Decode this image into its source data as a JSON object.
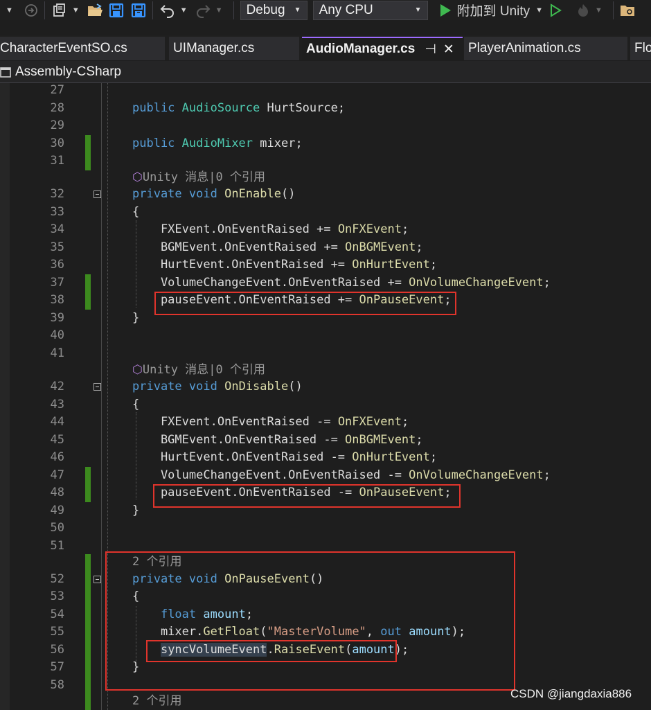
{
  "toolbar": {
    "config": "Debug",
    "platform": "Any CPU",
    "attach_label": "附加到 Unity",
    "icons": [
      "dropdown-caret",
      "navigate-forward-icon",
      "new-item-icon",
      "open-folder-icon",
      "save-icon",
      "save-all-icon",
      "undo-icon",
      "redo-icon",
      "play-icon",
      "start-without-debug-icon",
      "hot-reload-icon",
      "folder-view-icon"
    ]
  },
  "tabs": [
    {
      "label": "CharacterEventSO.cs"
    },
    {
      "label": "UIManager.cs"
    },
    {
      "label": "AudioManager.cs",
      "active": true,
      "pin": "⊣",
      "close": "✕"
    },
    {
      "label": "PlayerAnimation.cs"
    },
    {
      "label": "Flo"
    }
  ],
  "navbar": {
    "project": "Assembly-CSharp"
  },
  "lines": [
    {
      "n": "27"
    },
    {
      "n": "28",
      "code": "public AudioSource HurtSource;"
    },
    {
      "n": "29"
    },
    {
      "n": "30",
      "code": "public AudioMixer mixer;"
    },
    {
      "n": "31"
    },
    {
      "lens": "Unity 消息|0 个引用"
    },
    {
      "n": "32",
      "code": "private void OnEnable()"
    },
    {
      "n": "33",
      "code": "{"
    },
    {
      "n": "34",
      "code": "FXEvent.OnEventRaised += OnFXEvent;"
    },
    {
      "n": "35",
      "code": "BGMEvent.OnEventRaised += OnBGMEvent;"
    },
    {
      "n": "36",
      "code": "HurtEvent.OnEventRaised += OnHurtEvent;"
    },
    {
      "n": "37",
      "code": "VolumeChangeEvent.OnEventRaised += OnVolumeChangeEvent;"
    },
    {
      "n": "38",
      "code": "pauseEvent.OnEventRaised += OnPauseEvent;"
    },
    {
      "n": "39",
      "code": "}"
    },
    {
      "n": "40"
    },
    {
      "n": "41"
    },
    {
      "lens": "Unity 消息|0 个引用"
    },
    {
      "n": "42",
      "code": "private void OnDisable()"
    },
    {
      "n": "43",
      "code": "{"
    },
    {
      "n": "44",
      "code": "FXEvent.OnEventRaised -= OnFXEvent;"
    },
    {
      "n": "45",
      "code": "BGMEvent.OnEventRaised -= OnBGMEvent;"
    },
    {
      "n": "46",
      "code": "HurtEvent.OnEventRaised -= OnHurtEvent;"
    },
    {
      "n": "47",
      "code": "VolumeChangeEvent.OnEventRaised -= OnVolumeChangeEvent;"
    },
    {
      "n": "48",
      "code": "pauseEvent.OnEventRaised -= OnPauseEvent;"
    },
    {
      "n": "49",
      "code": "}"
    },
    {
      "n": "50"
    },
    {
      "n": "51"
    },
    {
      "lens": "2 个引用"
    },
    {
      "n": "52",
      "code": "private void OnPauseEvent()"
    },
    {
      "n": "53",
      "code": "{"
    },
    {
      "n": "54",
      "code": "float amount;"
    },
    {
      "n": "55",
      "code": "mixer.GetFloat(\"MasterVolume\", out amount);"
    },
    {
      "n": "56",
      "code": "syncVolumeEvent.RaiseEvent(amount);"
    },
    {
      "n": "57",
      "code": "}"
    },
    {
      "n": "58"
    },
    {
      "lens": "2 个引用"
    }
  ],
  "watermark": "CSDN @jiangdaxia886",
  "colors": {
    "keyword": "#569cd6",
    "type": "#4ec9b0",
    "method": "#dcdcaa",
    "string": "#d69d85",
    "change_bar": "#3c8a1e",
    "highlight_box": "#e0342c",
    "active_tab_accent": "#9d6bff"
  }
}
